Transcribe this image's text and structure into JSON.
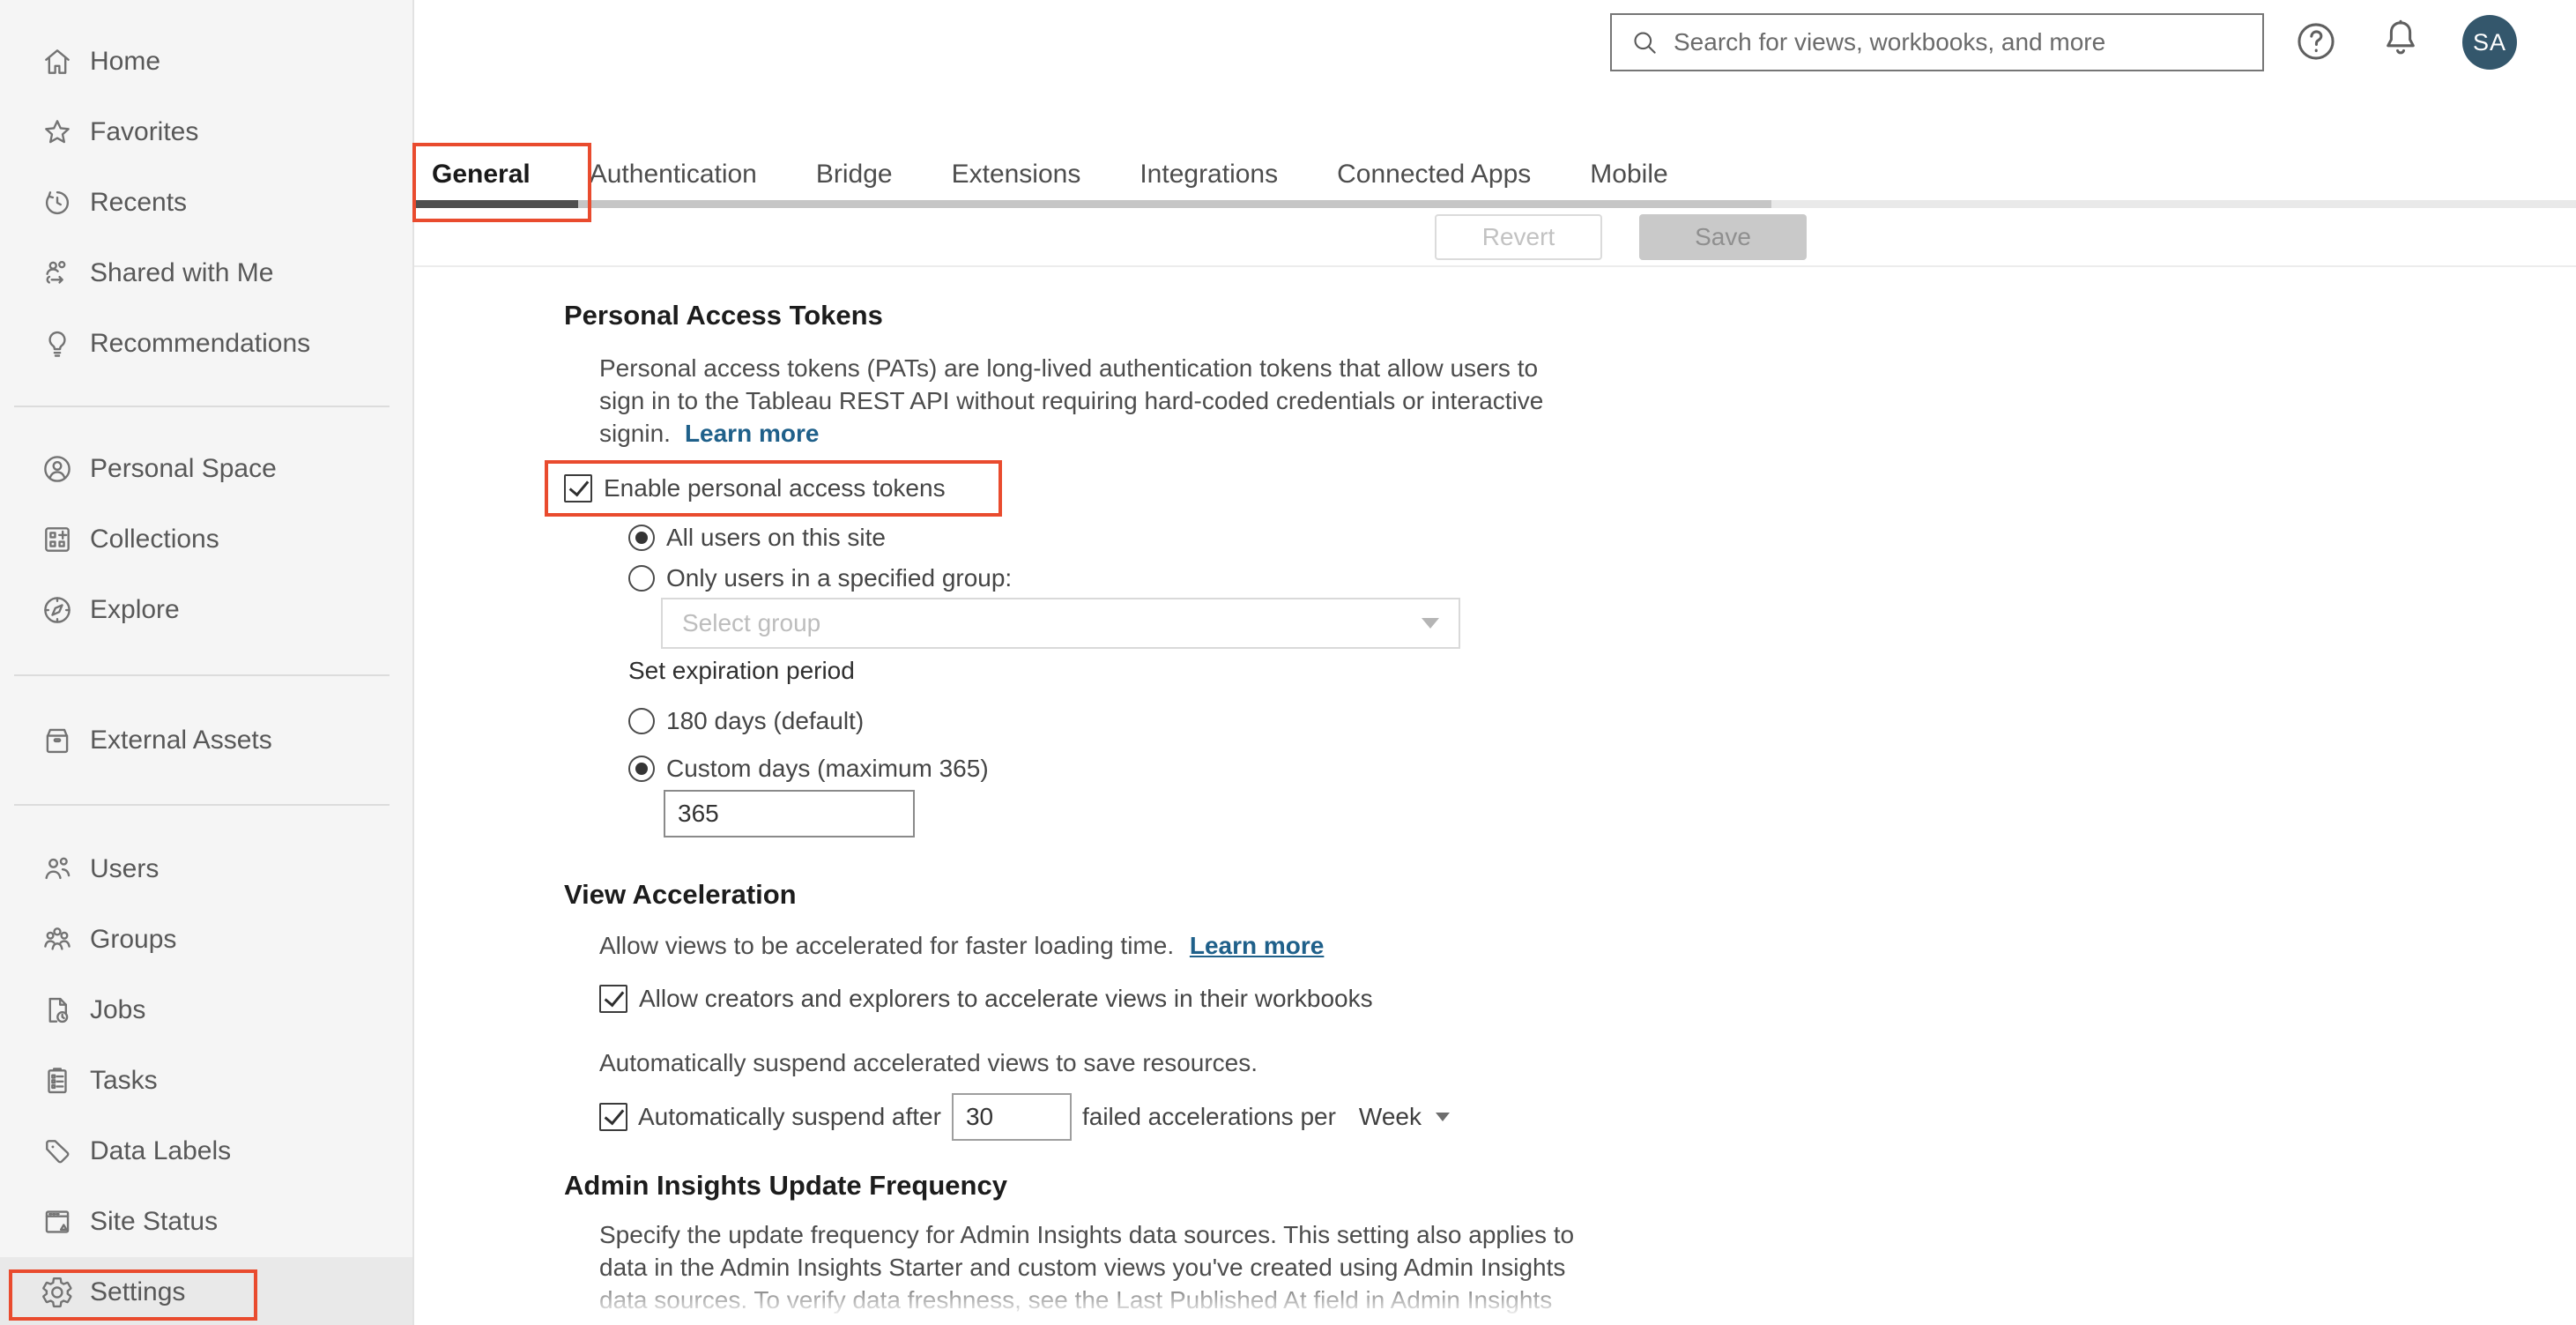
{
  "header": {
    "search_placeholder": "Search for views, workbooks, and more",
    "avatar_initials": "SA"
  },
  "sidebar": {
    "sections": [
      {
        "items": [
          {
            "label": "Home",
            "icon": "home-icon"
          },
          {
            "label": "Favorites",
            "icon": "star-icon"
          },
          {
            "label": "Recents",
            "icon": "recents-icon"
          },
          {
            "label": "Shared with Me",
            "icon": "shared-icon"
          },
          {
            "label": "Recommendations",
            "icon": "lightbulb-icon"
          }
        ]
      },
      {
        "items": [
          {
            "label": "Personal Space",
            "icon": "person-circle-icon"
          },
          {
            "label": "Collections",
            "icon": "collections-icon"
          },
          {
            "label": "Explore",
            "icon": "compass-icon"
          }
        ]
      },
      {
        "items": [
          {
            "label": "External Assets",
            "icon": "drawer-icon"
          }
        ]
      },
      {
        "items": [
          {
            "label": "Users",
            "icon": "users-icon"
          },
          {
            "label": "Groups",
            "icon": "groups-icon"
          },
          {
            "label": "Jobs",
            "icon": "jobs-icon"
          },
          {
            "label": "Tasks",
            "icon": "tasks-icon"
          },
          {
            "label": "Data Labels",
            "icon": "tag-icon"
          },
          {
            "label": "Site Status",
            "icon": "site-status-icon"
          },
          {
            "label": "Settings",
            "icon": "gear-icon",
            "active": true
          }
        ]
      }
    ]
  },
  "tabs": {
    "active": "General",
    "items": [
      {
        "label": "General"
      },
      {
        "label": "Authentication"
      },
      {
        "label": "Bridge"
      },
      {
        "label": "Extensions"
      },
      {
        "label": "Integrations"
      },
      {
        "label": "Connected Apps"
      },
      {
        "label": "Mobile"
      }
    ]
  },
  "toolbar": {
    "revert_label": "Revert",
    "save_label": "Save"
  },
  "content": {
    "pat": {
      "title": "Personal Access Tokens",
      "description_lines": [
        "Personal access tokens (PATs) are long-lived authentication tokens that allow users to",
        "sign in to the Tableau REST API without requiring hard-coded credentials or interactive",
        "signin."
      ],
      "learn_more_label": "Learn more",
      "enable_checkbox_label": "Enable personal access tokens",
      "enable_checked": true,
      "scope_all_users_label": "All users on this site",
      "scope_group_label": "Only users in a specified group:",
      "selected_scope": "All users on this site",
      "group_select_placeholder": "Select group",
      "expiration_heading": "Set expiration period",
      "expiration_default_label": "180 days (default)",
      "expiration_custom_label": "Custom days (maximum 365)",
      "selected_expiration": "Custom days (maximum 365)",
      "custom_days_value": "365"
    },
    "view_acceleration": {
      "title": "View Acceleration",
      "description": "Allow views to be accelerated for faster loading time.",
      "learn_more_label": "Learn more",
      "allow_checkbox_label": "Allow creators and explorers to accelerate views in their workbooks",
      "allow_checked": true,
      "suspend_description": "Automatically suspend accelerated views to save resources.",
      "suspend_checkbox_label": "Automatically suspend after",
      "suspend_checked": true,
      "suspend_threshold_value": "30",
      "suspend_suffix_label": "failed accelerations per",
      "suspend_period_value": "Week"
    },
    "admin_insights": {
      "title": "Admin Insights Update Frequency",
      "description_lines": [
        "Specify the update frequency for Admin Insights data sources. This setting also applies to",
        "data in the Admin Insights Starter and custom views you've created using Admin Insights",
        "data sources. To verify data freshness, see the Last Published At field in Admin Insights"
      ]
    }
  },
  "colors": {
    "annotation": "#e94b2e",
    "link": "#1f608a",
    "avatar_bg": "#34576c",
    "active_tab_indicator": "#4f4f4f",
    "sidebar_bg": "#f5f5f5"
  }
}
